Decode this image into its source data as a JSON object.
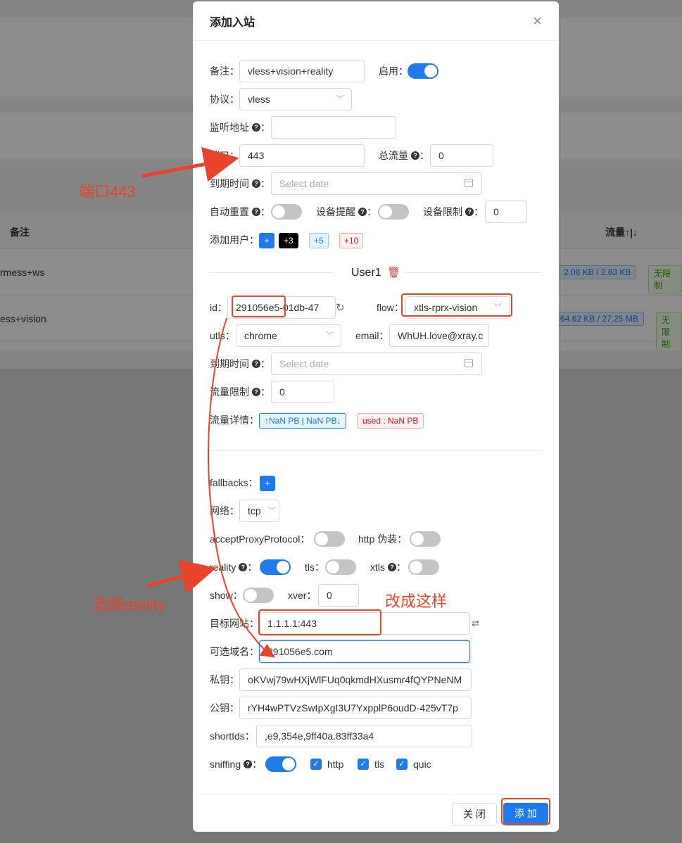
{
  "background": {
    "table_header_remark": "备注",
    "table_header_traffic": "流量↑|↓",
    "rows": [
      {
        "remark": "rmess+ws",
        "traffic": "2.08 KB / 2.83 KB",
        "limit": "无限制"
      },
      {
        "remark": "ess+vision",
        "traffic": "64.62 KB / 27.25 MB",
        "limit": "无限制"
      }
    ]
  },
  "modal": {
    "title": "添加入站",
    "close": "×",
    "remark_label": "备注",
    "remark_value": "vless+vision+reality",
    "enable_label": "启用",
    "enable_on": true,
    "protocol_label": "协议",
    "protocol_value": "vless",
    "listen_label": "监听地址",
    "listen_value": "",
    "port_label": "端口",
    "port_value": "443",
    "total_label": "总流量",
    "total_value": "0",
    "expire_label": "到期时间",
    "expire_placeholder": "Select date",
    "auto_reset_label": "自动重置",
    "device_alert_label": "设备提醒",
    "device_limit_label": "设备限制",
    "device_limit_value": "0",
    "add_user_label": "添加用户",
    "add_user_buttons": [
      "+",
      "+3",
      "+5",
      "+10"
    ],
    "user_title": "User1",
    "id_label": "id",
    "id_value": "291056e5-01db-47",
    "flow_label": "flow",
    "flow_value": "xtls-rprx-vision",
    "utls_label": "utls",
    "utls_value": "chrome",
    "email_label": "email",
    "email_value": "WhUH.love@xray.c",
    "user_expire_label": "到期时间",
    "user_expire_placeholder": "Select date",
    "traffic_limit_label": "流量限制",
    "traffic_limit_value": "0",
    "traffic_detail_label": "流量详情",
    "traffic_detail_tag": "↑NaN PB | NaN PB↓",
    "traffic_used_tag": "used : NaN PB",
    "fallbacks_label": "fallbacks",
    "fallbacks_button": "+",
    "network_label": "网络",
    "network_value": "tcp",
    "accept_proxy_label": "acceptProxyProtocol",
    "http_disguise_label": "http 伪装",
    "reality_label": "reality",
    "tls_label": "tls",
    "xtls_label": "xtls",
    "show_label": "show",
    "xver_label": "xver",
    "xver_value": "0",
    "dest_label": "目标网站",
    "dest_value": "1.1.1.1:443",
    "server_names_label": "可选域名",
    "server_names_value": "291056e5.com",
    "private_key_label": "私钥",
    "private_key_value": "oKVwj79wHXjWlFUq0qkmdHXusmr4fQYPNeNM",
    "public_key_label": "公钥",
    "public_key_value": "rYH4wPTVzSwtpXgI3U7YxpplP6oudD-425vT7p",
    "short_ids_label": "shortIds",
    "short_ids_value": ",e9,354e,9ff40a,83ff33a4",
    "sniffing_label": "sniffing",
    "sniff_http": "http",
    "sniff_tls": "tls",
    "sniff_quic": "quic",
    "close_button": "关 闭",
    "add_button": "添 加"
  },
  "annotations": {
    "port_note": "端口443",
    "reality_note": "选择reality",
    "change_note": "改成这样"
  },
  "colors": {
    "accent": "#1f7aec",
    "annotation": "#e8432b"
  }
}
